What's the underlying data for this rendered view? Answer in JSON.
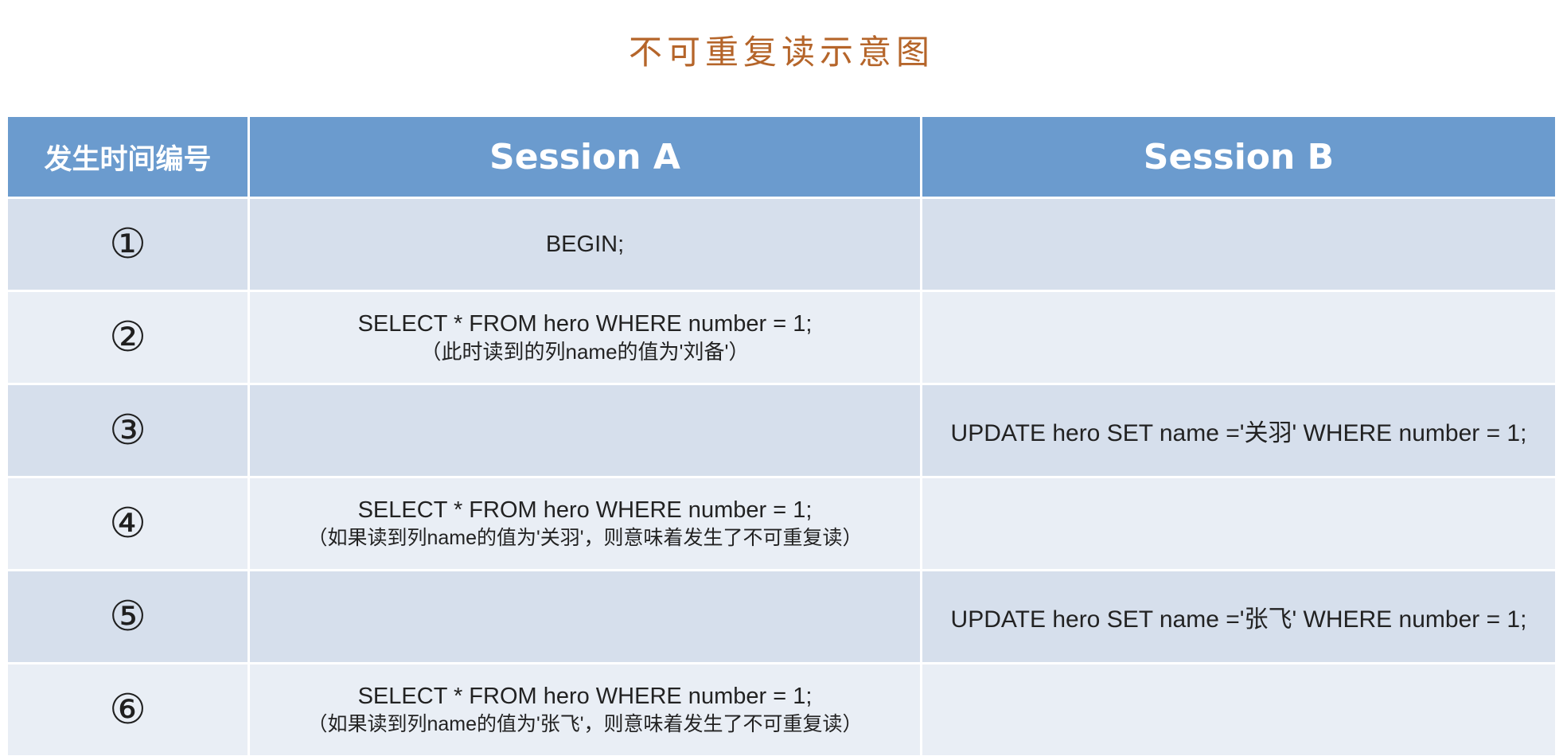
{
  "title": "不可重复读示意图",
  "header": {
    "time_col": "发生时间编号",
    "session_a": "Session A",
    "session_b": "Session B"
  },
  "rows": [
    {
      "step": "①",
      "a_sql": "BEGIN;",
      "a_note": "",
      "b_sql": ""
    },
    {
      "step": "②",
      "a_sql": "SELECT * FROM hero WHERE number = 1;",
      "a_note": "（此时读到的列name的值为'刘备'）",
      "b_sql": ""
    },
    {
      "step": "③",
      "a_sql": "",
      "a_note": "",
      "b_sql": "UPDATE hero SET name ='关羽' WHERE number = 1;"
    },
    {
      "step": "④",
      "a_sql": "SELECT * FROM hero WHERE number = 1;",
      "a_note": "（如果读到列name的值为'关羽'，则意味着发生了不可重复读）",
      "b_sql": ""
    },
    {
      "step": "⑤",
      "a_sql": "",
      "a_note": "",
      "b_sql": "UPDATE hero SET name ='张飞' WHERE number = 1;"
    },
    {
      "step": "⑥",
      "a_sql": "SELECT * FROM hero WHERE number = 1;",
      "a_note": "（如果读到列name的值为'张飞'，则意味着发生了不可重复读）",
      "b_sql": ""
    }
  ],
  "colors": {
    "header_bg": "#6b9bce",
    "row_dark": "#d6dfec",
    "row_light": "#e9eef5",
    "title": "#b5652a"
  }
}
